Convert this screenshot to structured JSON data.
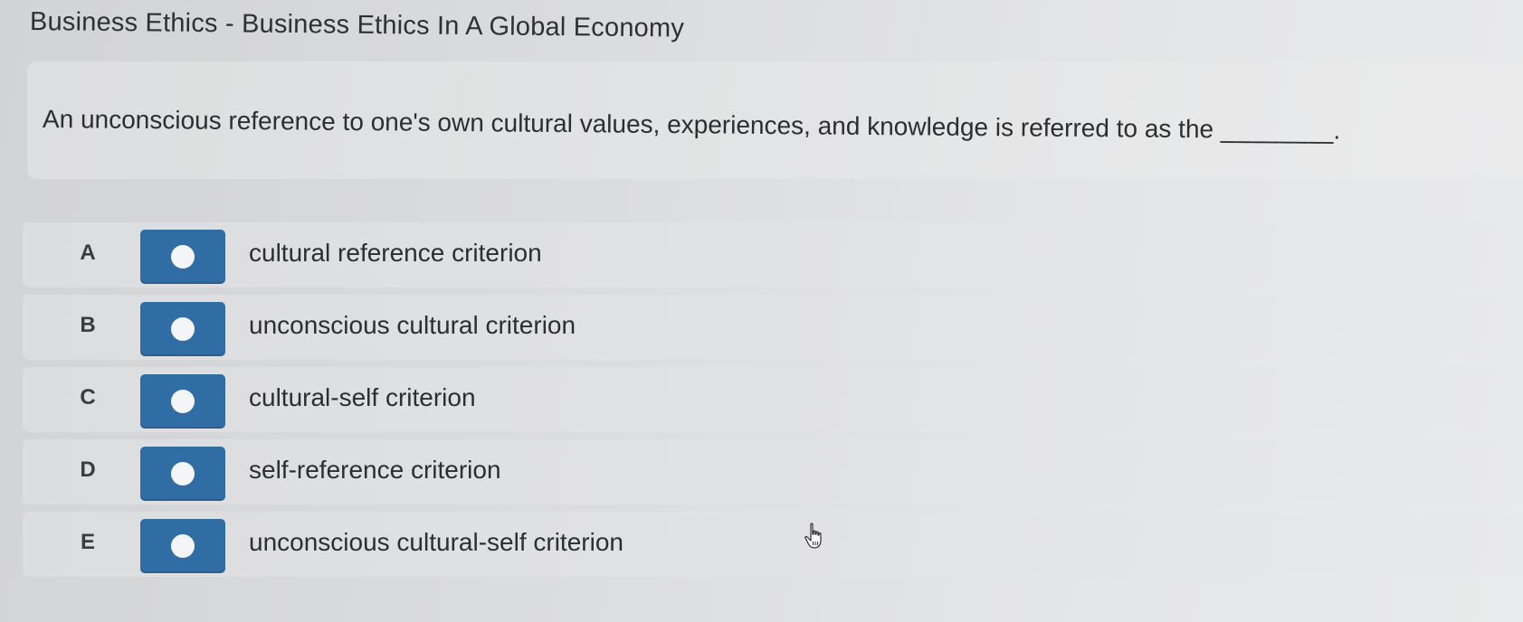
{
  "header": {
    "title": "Business Ethics - Business Ethics In A Global Economy"
  },
  "question": {
    "text": "An unconscious reference to one's own cultural values, experiences, and knowledge is referred to as the ________."
  },
  "options": [
    {
      "letter": "A",
      "label": "cultural reference criterion"
    },
    {
      "letter": "B",
      "label": "unconscious cultural criterion"
    },
    {
      "letter": "C",
      "label": "cultural-self criterion"
    },
    {
      "letter": "D",
      "label": "self-reference criterion"
    },
    {
      "letter": "E",
      "label": "unconscious cultural-self criterion"
    }
  ],
  "colors": {
    "radio_accent": "#2f6da4",
    "background": "#dadbdd"
  },
  "icons": {
    "cursor": "hand-pointer-icon",
    "radio": "radio-button-icon"
  }
}
